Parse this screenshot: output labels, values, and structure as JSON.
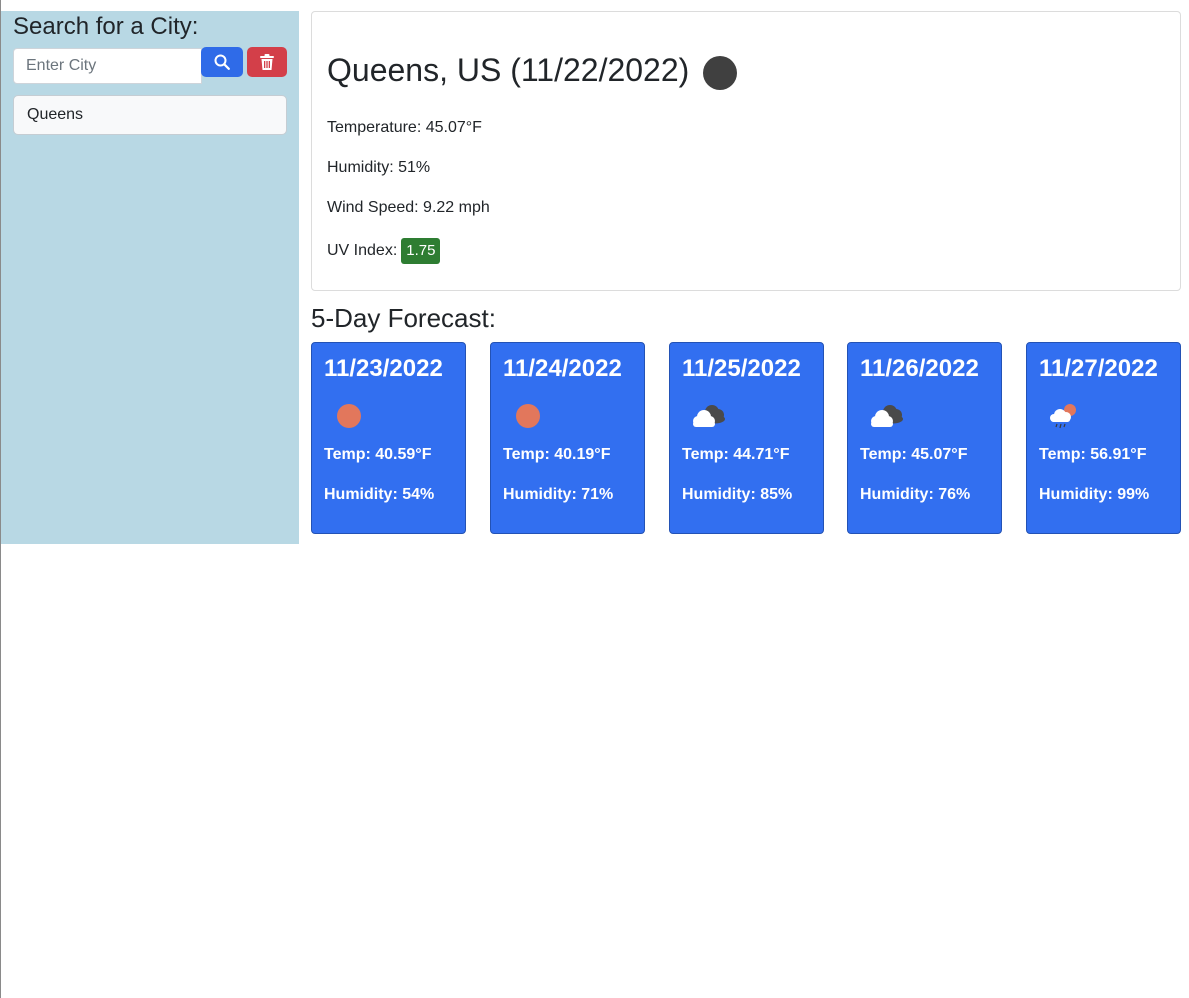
{
  "sidebar": {
    "title": "Search for a City:",
    "search": {
      "placeholder": "Enter City",
      "value": ""
    },
    "search_button_icon": "search-icon",
    "clear_button_icon": "trash-icon",
    "history": [
      "Queens"
    ]
  },
  "current": {
    "title": "Queens, US (11/22/2022)",
    "icon": "moon-icon",
    "temperature": "Temperature: 45.07°F",
    "humidity": "Humidity: 51%",
    "wind": "Wind Speed: 9.22 mph",
    "uv_label": "UV Index:",
    "uv_value": "1.75"
  },
  "forecast": {
    "title": "5-Day Forecast:",
    "days": [
      {
        "date": "11/23/2022",
        "icon": "sun-icon",
        "temp": "Temp: 40.59°F",
        "humidity": "Humidity: 54%"
      },
      {
        "date": "11/24/2022",
        "icon": "sun-icon",
        "temp": "Temp: 40.19°F",
        "humidity": "Humidity: 71%"
      },
      {
        "date": "11/25/2022",
        "icon": "clouds-icon",
        "temp": "Temp: 44.71°F",
        "humidity": "Humidity: 85%"
      },
      {
        "date": "11/26/2022",
        "icon": "clouds-icon",
        "temp": "Temp: 45.07°F",
        "humidity": "Humidity: 76%"
      },
      {
        "date": "11/27/2022",
        "icon": "rain-sun-icon",
        "temp": "Temp: 56.91°F",
        "humidity": "Humidity: 99%"
      }
    ]
  },
  "colors": {
    "sidebar_bg": "#b8d8e4",
    "search_button": "#2f6be8",
    "clear_button": "#d33f49",
    "forecast_card": "#326ff0",
    "uv_badge": "#2e7d32",
    "sun": "#e2775c"
  }
}
